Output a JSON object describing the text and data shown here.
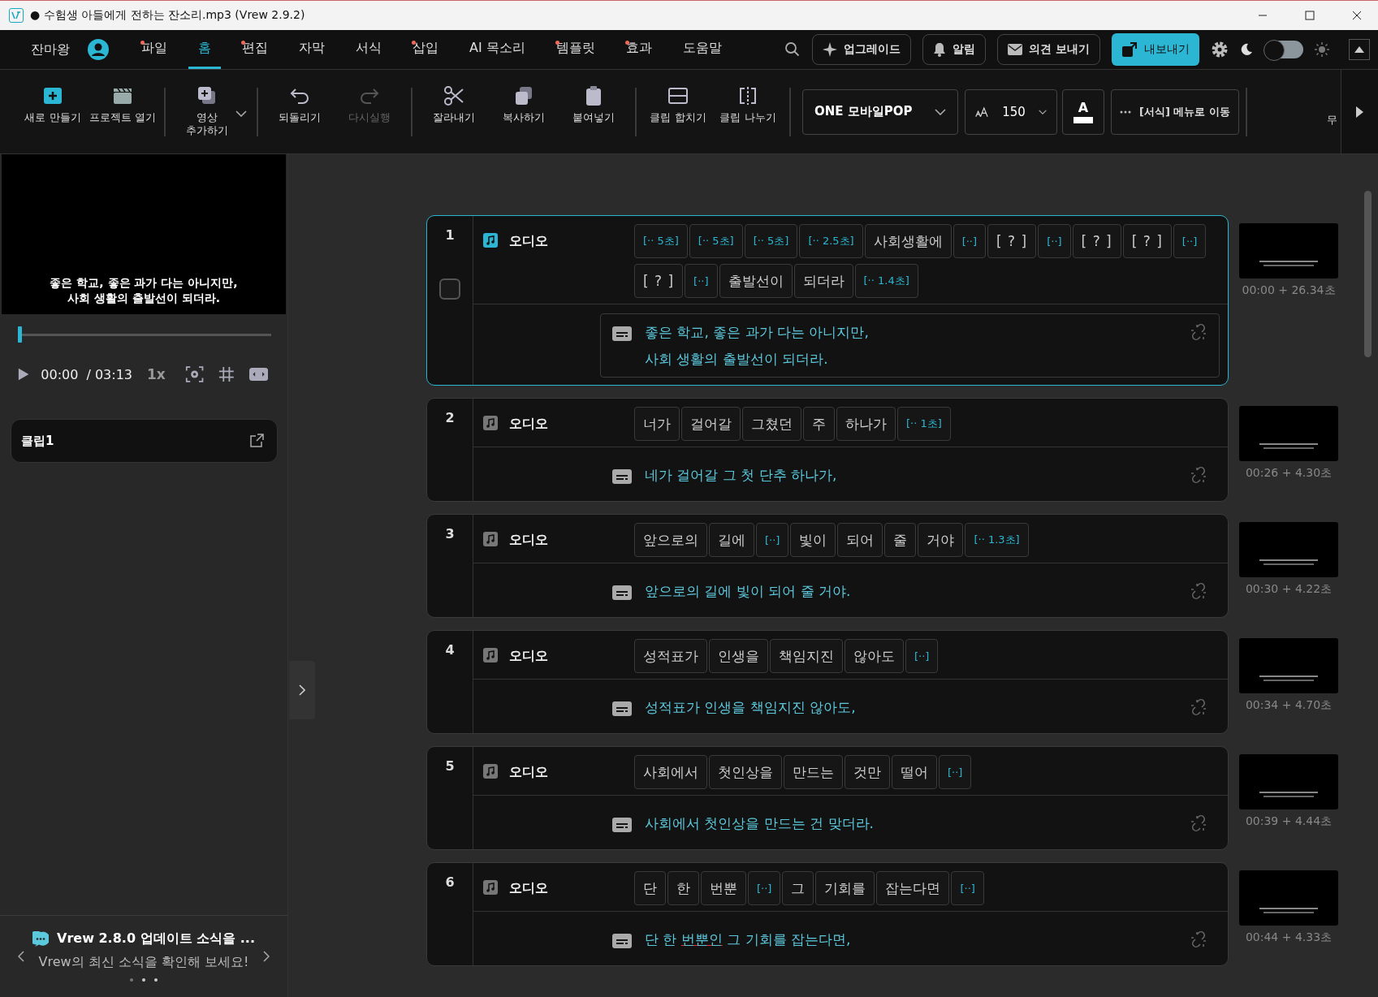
{
  "window": {
    "title": "● 수험생 아들에게 전하는 잔소리.mp3 (Vrew 2.9.2)"
  },
  "menu": {
    "user": "잔마왕",
    "tabs": [
      {
        "label": "파일",
        "selected": false,
        "dot": true
      },
      {
        "label": "홈",
        "selected": true,
        "dot": false
      },
      {
        "label": "편집",
        "selected": false,
        "dot": true
      },
      {
        "label": "자막",
        "selected": false,
        "dot": false
      },
      {
        "label": "서식",
        "selected": false,
        "dot": false
      },
      {
        "label": "삽입",
        "selected": false,
        "dot": true
      },
      {
        "label": "AI 목소리",
        "selected": false,
        "dot": false
      },
      {
        "label": "템플릿",
        "selected": false,
        "dot": true
      },
      {
        "label": "효과",
        "selected": false,
        "dot": true
      },
      {
        "label": "도움말",
        "selected": false,
        "dot": false
      }
    ],
    "buttons": [
      "업그레이드",
      "알림",
      "의견 보내기"
    ],
    "export_button": "내보내기",
    "dark_mode_toggle": {
      "on": false
    }
  },
  "toolbar": {
    "groups": [
      {
        "items": [
          {
            "label": "새로 만들기",
            "disabled": false
          },
          {
            "label": "프로젝트 열기",
            "disabled": false
          }
        ]
      },
      {
        "items": [
          {
            "label": "영상\n추가하기",
            "disabled": false,
            "dropdown": true
          }
        ]
      },
      {
        "items": [
          {
            "label": "되돌리기",
            "disabled": false
          },
          {
            "label": "다시실행",
            "disabled": true
          }
        ]
      },
      {
        "items": [
          {
            "label": "잘라내기",
            "disabled": false
          },
          {
            "label": "복사하기",
            "disabled": false
          },
          {
            "label": "붙여넣기",
            "disabled": false
          }
        ]
      },
      {
        "items": [
          {
            "label": "클립 합치기",
            "disabled": false
          },
          {
            "label": "클립 나누기",
            "disabled": false
          }
        ]
      }
    ],
    "font": "ONE 모바일POP",
    "font_size": "150",
    "color_button": "A",
    "format_button": "[서식] 메뉴로 이동",
    "cut_item": "무"
  },
  "preview": {
    "subtitle": [
      "좋은 학교, 좋은 과가 다는 아니지만,",
      "사회 생활의 출발선이 되더라."
    ],
    "time": "00:00",
    "duration": "/ 03:13",
    "speed": "1x",
    "level": 0
  },
  "clip_list": {
    "items": [
      {
        "label": "클립1"
      }
    ]
  },
  "news": {
    "title": "Vrew 2.8.0 업데이트 소식을 ...",
    "text": "Vrew의 최신 소식을 확인해 보세요!"
  },
  "clips": [
    {
      "number": "1",
      "track": "오디오",
      "selected": true,
      "checked": false,
      "thumb_time": "00:00 + 26.34초",
      "tokens": [
        {
          "text": "[·· 5초]",
          "kind": "pause"
        },
        {
          "text": "[·· 5초]",
          "kind": "pause"
        },
        {
          "text": "[·· 5초]",
          "kind": "pause"
        },
        {
          "text": "[·· 2.5초]",
          "kind": "pause"
        },
        {
          "text": "사회생활에",
          "kind": "word"
        },
        {
          "text": "[··]",
          "kind": "pause"
        },
        {
          "text": "[ ? ]",
          "kind": "unknown"
        },
        {
          "text": "[··]",
          "kind": "pause"
        },
        {
          "text": "[ ? ]",
          "kind": "unknown"
        },
        {
          "text": "[ ? ]",
          "kind": "unknown"
        },
        {
          "text": "[··]",
          "kind": "pause"
        },
        {
          "text": "[ ? ]",
          "kind": "unknown"
        },
        {
          "text": "[··]",
          "kind": "pause"
        },
        {
          "text": "출발선이",
          "kind": "word"
        },
        {
          "text": "되더라",
          "kind": "word"
        },
        {
          "text": "[·· 1.4초]",
          "kind": "pause"
        }
      ],
      "subtitle": [
        [
          {
            "text": "좋은 학교, 좋은 과가 다는 아니지만,",
            "flagged": false
          }
        ],
        [
          {
            "text": "사회 생활의 출발선이 되더라.",
            "flagged": false
          }
        ]
      ]
    },
    {
      "number": "2",
      "track": "오디오",
      "selected": false,
      "thumb_time": "00:26 + 4.30초",
      "tokens": [
        {
          "text": "너가",
          "kind": "word"
        },
        {
          "text": "걸어갈",
          "kind": "word"
        },
        {
          "text": "그쳤던",
          "kind": "word"
        },
        {
          "text": "주",
          "kind": "word"
        },
        {
          "text": "하나가",
          "kind": "word"
        },
        {
          "text": "[·· 1초]",
          "kind": "pause"
        }
      ],
      "subtitle": [
        [
          {
            "text": "네가 걸어갈 그 첫 단추 하나가,",
            "flagged": false
          }
        ]
      ]
    },
    {
      "number": "3",
      "track": "오디오",
      "selected": false,
      "thumb_time": "00:30 + 4.22초",
      "tokens": [
        {
          "text": "앞으로의",
          "kind": "word"
        },
        {
          "text": "길에",
          "kind": "word"
        },
        {
          "text": "[··]",
          "kind": "pause"
        },
        {
          "text": "빛이",
          "kind": "word"
        },
        {
          "text": "되어",
          "kind": "word"
        },
        {
          "text": "줄",
          "kind": "word"
        },
        {
          "text": "거야",
          "kind": "word"
        },
        {
          "text": "[·· 1.3초]",
          "kind": "pause"
        }
      ],
      "subtitle": [
        [
          {
            "text": "앞으로의 길에 빛이 되어 줄 거야.",
            "flagged": false
          }
        ]
      ]
    },
    {
      "number": "4",
      "track": "오디오",
      "selected": false,
      "thumb_time": "00:34 + 4.70초",
      "tokens": [
        {
          "text": "성적표가",
          "kind": "word"
        },
        {
          "text": "인생을",
          "kind": "word"
        },
        {
          "text": "책임지진",
          "kind": "word"
        },
        {
          "text": "않아도",
          "kind": "word"
        },
        {
          "text": "[··]",
          "kind": "pause"
        }
      ],
      "subtitle": [
        [
          {
            "text": "성적표가 인생을 책임지진 않아도,",
            "flagged": false
          }
        ]
      ]
    },
    {
      "number": "5",
      "track": "오디오",
      "selected": false,
      "thumb_time": "00:39 + 4.44초",
      "tokens": [
        {
          "text": "사회에서",
          "kind": "word"
        },
        {
          "text": "첫인상을",
          "kind": "word"
        },
        {
          "text": "만드는",
          "kind": "word"
        },
        {
          "text": "것만",
          "kind": "word"
        },
        {
          "text": "떨어",
          "kind": "word"
        },
        {
          "text": "[··]",
          "kind": "pause"
        }
      ],
      "subtitle": [
        [
          {
            "text": "사회에서 첫인상을 만드는 건 맞더라.",
            "flagged": false
          }
        ]
      ]
    },
    {
      "number": "6",
      "track": "오디오",
      "selected": false,
      "thumb_time": "00:44 + 4.33초",
      "tokens": [
        {
          "text": "단",
          "kind": "word"
        },
        {
          "text": "한",
          "kind": "word"
        },
        {
          "text": "번뿐",
          "kind": "word"
        },
        {
          "text": "[··]",
          "kind": "pause"
        },
        {
          "text": "그",
          "kind": "word"
        },
        {
          "text": "기회를",
          "kind": "word"
        },
        {
          "text": "잡는다면",
          "kind": "word"
        },
        {
          "text": "[··]",
          "kind": "pause"
        }
      ],
      "subtitle": [
        [
          {
            "text": "단 한 ",
            "flagged": false
          },
          {
            "text": "번뿐인",
            "flagged": true
          },
          {
            "text": " 그 기회를 잡는다면,",
            "flagged": false
          }
        ]
      ]
    }
  ]
}
